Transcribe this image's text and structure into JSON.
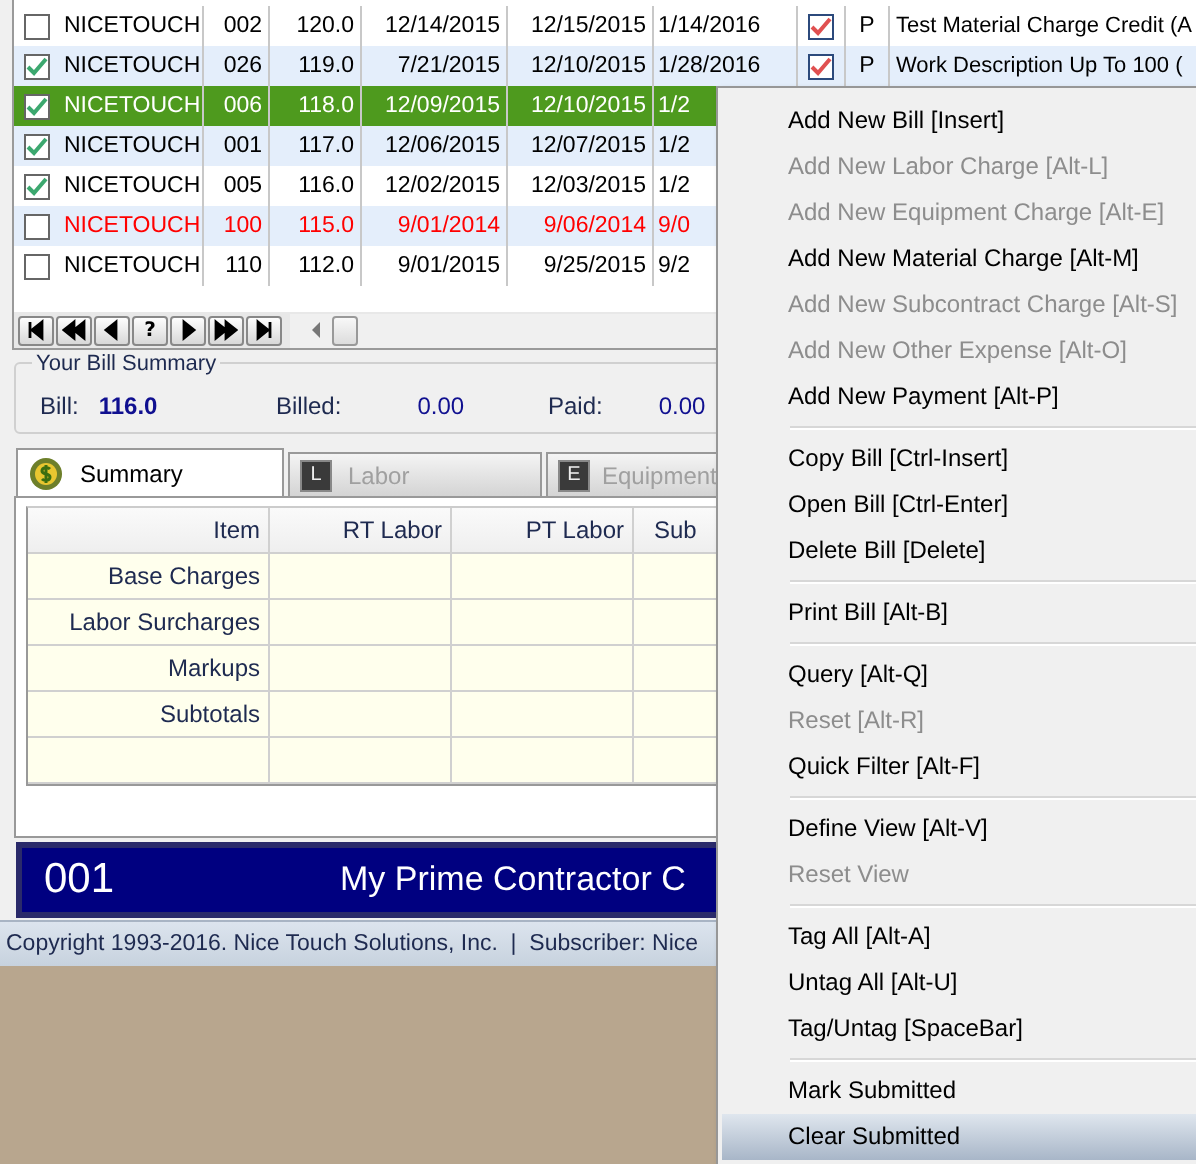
{
  "grid": {
    "rows": [
      {
        "tagged": false,
        "name": "NICETOUCH",
        "code": "002",
        "amount": "120.0",
        "date_1": "12/14/2015",
        "date_2": "12/15/2015",
        "date_3": "1/14/2016",
        "submitted": true,
        "type": "P",
        "description": "Test Material Charge Credit (A",
        "selected": false,
        "flagged": false
      },
      {
        "tagged": true,
        "name": "NICETOUCH",
        "code": "026",
        "amount": "119.0",
        "date_1": "7/21/2015",
        "date_2": "12/10/2015",
        "date_3": "1/28/2016",
        "submitted": true,
        "type": "P",
        "description": "Work Description Up To 100 (",
        "selected": false,
        "flagged": false
      },
      {
        "tagged": true,
        "name": "NICETOUCH",
        "code": "006",
        "amount": "118.0",
        "date_1": "12/09/2015",
        "date_2": "12/10/2015",
        "date_3": "1/2",
        "selected": true,
        "flagged": false
      },
      {
        "tagged": true,
        "name": "NICETOUCH",
        "code": "001",
        "amount": "117.0",
        "date_1": "12/06/2015",
        "date_2": "12/07/2015",
        "date_3": "1/2",
        "selected": false,
        "flagged": false
      },
      {
        "tagged": true,
        "name": "NICETOUCH",
        "code": "005",
        "amount": "116.0",
        "date_1": "12/02/2015",
        "date_2": "12/03/2015",
        "date_3": "1/2",
        "selected": false,
        "flagged": false
      },
      {
        "tagged": false,
        "name": "NICETOUCH",
        "code": "100",
        "amount": "115.0",
        "date_1": "9/01/2014",
        "date_2": "9/06/2014",
        "date_3": "9/0",
        "selected": false,
        "flagged": true
      },
      {
        "tagged": false,
        "name": "NICETOUCH",
        "code": "110",
        "amount": "112.0",
        "date_1": "9/01/2015",
        "date_2": "9/25/2015",
        "date_3": "9/2",
        "selected": false,
        "flagged": false
      }
    ],
    "navigator": [
      {
        "kind": "first"
      },
      {
        "kind": "prev-page"
      },
      {
        "kind": "prev"
      },
      {
        "kind": "help",
        "label": "?"
      },
      {
        "kind": "next"
      },
      {
        "kind": "next-page"
      },
      {
        "kind": "last"
      }
    ]
  },
  "bill_summary": {
    "title": "Your Bill Summary",
    "fields": [
      {
        "label": "Bill:",
        "value": "116.0"
      },
      {
        "label": "Billed:",
        "value": "0.00"
      },
      {
        "label": "Paid:",
        "value": "0.00"
      }
    ]
  },
  "tabs": [
    {
      "label": "Summary",
      "kind": "coin",
      "selected": true,
      "disabled": false
    },
    {
      "label": "Labor",
      "kind": "letter",
      "letter": "L",
      "selected": false,
      "disabled": true
    },
    {
      "label": "Equipment",
      "kind": "letter",
      "letter": "E",
      "selected": false,
      "disabled": true
    }
  ],
  "summary_table": {
    "columns": [
      "Item",
      "RT Labor",
      "PT Labor",
      "Sub"
    ],
    "rows": [
      "Base Charges",
      "Labor Surcharges",
      "Markups",
      "Subtotals",
      ""
    ]
  },
  "banner": {
    "number": "001",
    "name": "My Prime Contractor C"
  },
  "status_bar": "Copyright 1993-2016. Nice Touch Solutions, Inc.  |  Subscriber: Nice",
  "context_menu": [
    [
      {
        "label": "Add New Bill [Insert]",
        "disabled": false,
        "selected": false
      },
      {
        "label": "Add New Labor Charge [Alt-L]",
        "disabled": true,
        "selected": false
      },
      {
        "label": "Add New Equipment Charge [Alt-E]",
        "disabled": true,
        "selected": false
      },
      {
        "label": "Add New Material Charge [Alt-M]",
        "disabled": false,
        "selected": false
      },
      {
        "label": "Add New Subcontract Charge [Alt-S]",
        "disabled": true,
        "selected": false
      },
      {
        "label": "Add New Other Expense [Alt-O]",
        "disabled": true,
        "selected": false
      },
      {
        "label": "Add New Payment [Alt-P]",
        "disabled": false,
        "selected": false
      }
    ],
    [
      {
        "label": "Copy Bill [Ctrl-Insert]",
        "disabled": false,
        "selected": false
      },
      {
        "label": "Open Bill [Ctrl-Enter]",
        "disabled": false,
        "selected": false
      },
      {
        "label": "Delete Bill [Delete]",
        "disabled": false,
        "selected": false
      }
    ],
    [
      {
        "label": "Print Bill [Alt-B]",
        "disabled": false,
        "selected": false
      }
    ],
    [
      {
        "label": "Query [Alt-Q]",
        "disabled": false,
        "selected": false
      },
      {
        "label": "Reset [Alt-R]",
        "disabled": true,
        "selected": false
      },
      {
        "label": "Quick Filter [Alt-F]",
        "disabled": false,
        "selected": false
      }
    ],
    [
      {
        "label": "Define View [Alt-V]",
        "disabled": false,
        "selected": false
      },
      {
        "label": "Reset View",
        "disabled": true,
        "selected": false
      }
    ],
    [
      {
        "label": "Tag All [Alt-A]",
        "disabled": false,
        "selected": false
      },
      {
        "label": "Untag All [Alt-U]",
        "disabled": false,
        "selected": false
      },
      {
        "label": "Tag/Untag [SpaceBar]",
        "disabled": false,
        "selected": false
      }
    ],
    [
      {
        "label": "Mark Submitted",
        "disabled": false,
        "selected": false
      },
      {
        "label": "Clear Submitted",
        "disabled": false,
        "selected": true
      }
    ]
  ]
}
